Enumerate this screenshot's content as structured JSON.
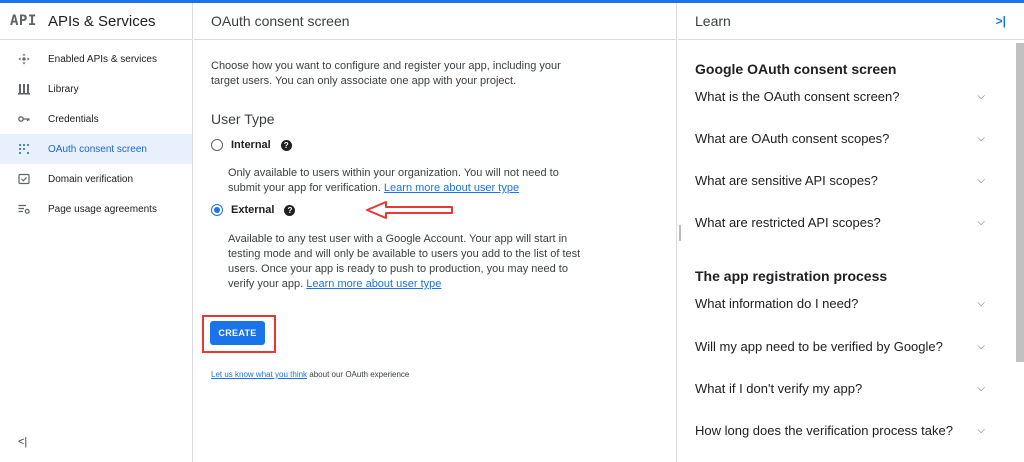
{
  "sidebar": {
    "logo": "API",
    "title": "APIs & Services",
    "items": [
      {
        "label": "Enabled APIs & services",
        "icon": "enabled-apis-icon"
      },
      {
        "label": "Library",
        "icon": "library-icon"
      },
      {
        "label": "Credentials",
        "icon": "key-icon"
      },
      {
        "label": "OAuth consent screen",
        "icon": "oauth-icon"
      },
      {
        "label": "Domain verification",
        "icon": "domain-verification-icon"
      },
      {
        "label": "Page usage agreements",
        "icon": "page-usage-icon"
      }
    ],
    "collapse_label": "<|"
  },
  "main": {
    "title": "OAuth consent screen",
    "intro": "Choose how you want to configure and register your app, including your target users. You can only associate one app with your project.",
    "user_type_label": "User Type",
    "internal": {
      "label": "Internal",
      "desc": "Only available to users within your organization. You will not need to submit your app for verification.",
      "link": "Learn more about user type"
    },
    "external": {
      "label": "External",
      "desc": "Available to any test user with a Google Account. Your app will start in testing mode and will only be available to users you add to the list of test users. Once your app is ready to push to production, you may need to verify your app.",
      "link": "Learn more about user type"
    },
    "create_label": "CREATE",
    "feedback_link": "Let us know what you think",
    "feedback_rest": " about our OAuth experience",
    "help_glyph": "?"
  },
  "learn": {
    "title": "Learn",
    "close_glyph": ">|",
    "sections": [
      {
        "title": "Google OAuth consent screen",
        "faqs": [
          "What is the OAuth consent screen?",
          "What are OAuth consent scopes?",
          "What are sensitive API scopes?",
          "What are restricted API scopes?"
        ]
      },
      {
        "title": "The app registration process",
        "faqs": [
          "What information do I need?",
          "Will my app need to be verified by Google?",
          "What if I don't verify my app?",
          "How long does the verification process take?"
        ]
      }
    ]
  },
  "colors": {
    "accent": "#1a73e8",
    "annotation_red": "#e53935"
  }
}
